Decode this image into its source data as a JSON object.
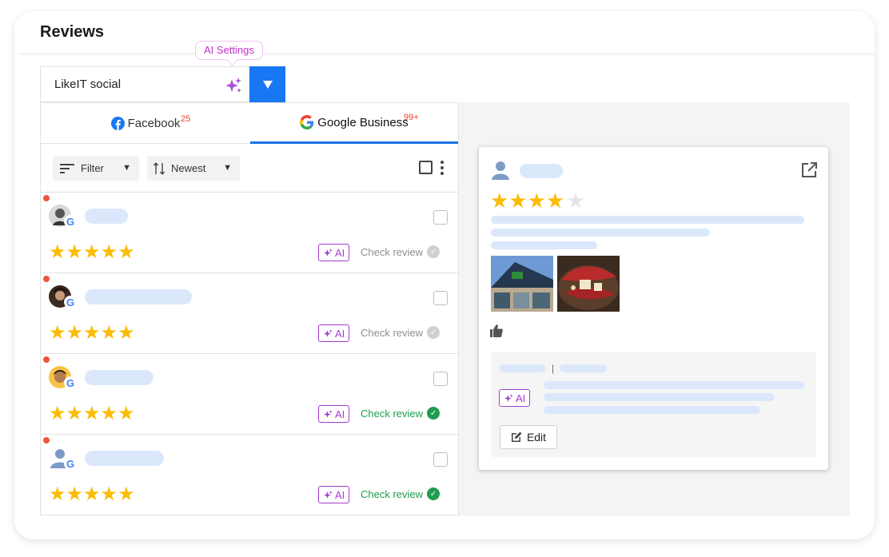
{
  "page": {
    "title": "Reviews"
  },
  "ai_settings": {
    "tooltip": "AI Settings",
    "icon": "sparkle-icon"
  },
  "account": {
    "name": "LikeIT social",
    "dropdown_icon": "caret-down-icon"
  },
  "tabs": [
    {
      "label": "Facebook",
      "badge": "25",
      "icon": "facebook-icon",
      "active": false
    },
    {
      "label": "Google Business",
      "badge": "99+",
      "icon": "google-icon",
      "active": true
    }
  ],
  "toolbar": {
    "filter_label": "Filter",
    "sort_label": "Newest",
    "caret": "▼"
  },
  "reviews": [
    {
      "unread": true,
      "stars": "★★★★★",
      "rating": 5,
      "ai": "AI",
      "status": "Check review",
      "checked": false,
      "status_state": "pending"
    },
    {
      "unread": true,
      "stars": "★★★★★",
      "rating": 5,
      "ai": "AI",
      "status": "Check review",
      "checked": false,
      "status_state": "pending"
    },
    {
      "unread": true,
      "stars": "★★★★★",
      "rating": 5,
      "ai": "AI",
      "status": "Check review",
      "checked": false,
      "status_state": "done"
    },
    {
      "unread": true,
      "stars": "★★★★★",
      "rating": 5,
      "ai": "AI",
      "status": "Check review",
      "checked": false,
      "status_state": "done"
    }
  ],
  "detail": {
    "rating": 4,
    "stars_on": "★★★★",
    "stars_off": "★",
    "reply_ai": "AI",
    "reply_separator": "|",
    "edit_label": "Edit"
  },
  "colors": {
    "accent": "#1877f2",
    "google_tab_underline": "#1a73e8",
    "star": "#fbbc05",
    "ai": "#a43bd0",
    "status_done": "#1f9d4e",
    "unread_dot": "#f0533c",
    "skeleton": "#dbe8fc"
  }
}
